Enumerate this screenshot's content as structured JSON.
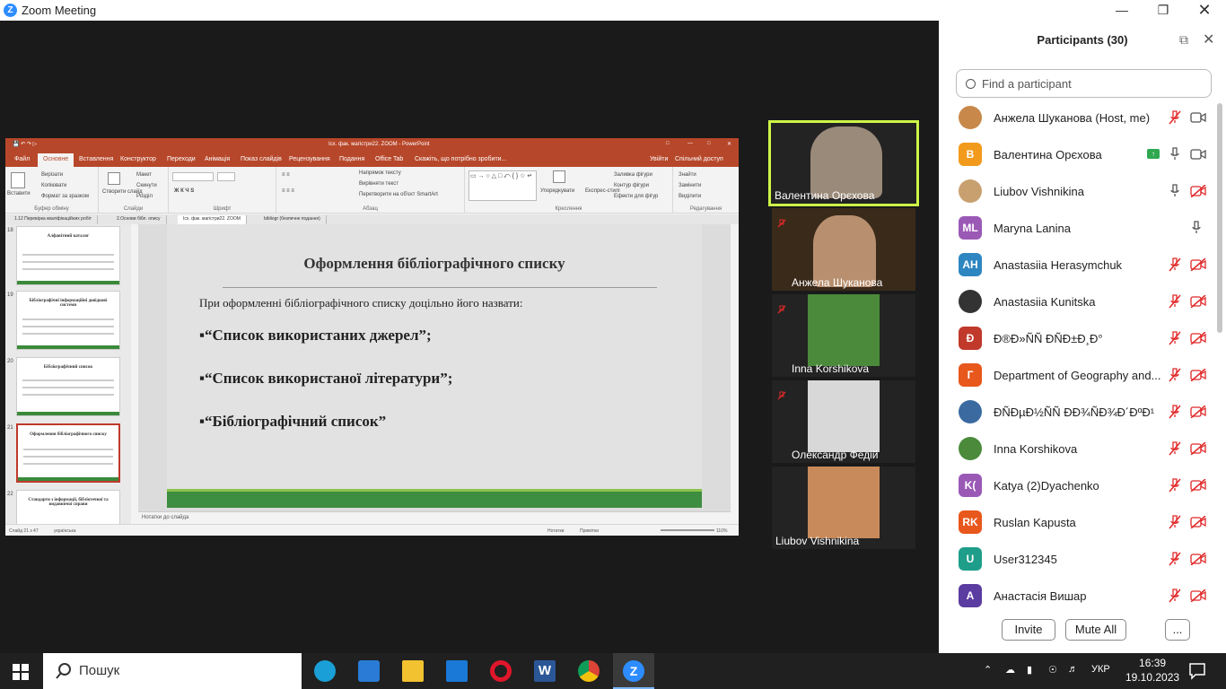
{
  "window": {
    "title": "Zoom Meeting",
    "logo": "Z"
  },
  "ppt": {
    "doc_title": "Ісх. фак. магістри22. ZOOM - PowerPoint",
    "tabs": [
      "Файл",
      "Основне",
      "Вставлення",
      "Конструктор",
      "Переходи",
      "Анімація",
      "Показ слайдів",
      "Рецензування",
      "Подання",
      "Office Tab",
      "Скажіть, що потрібно зробити...",
      "Увійти",
      "Спільний доступ"
    ],
    "ribbon": {
      "groups": [
        "Буфер обміну",
        "Слайди",
        "Шрифт",
        "Абзац",
        "Креслення",
        "Редагування"
      ],
      "clipboard": [
        "Вставити",
        "Вирізати",
        "Копіювати",
        "Формат за зразком"
      ],
      "slides": [
        "Створити слайд",
        "Макет",
        "Скинути",
        "Розділ"
      ],
      "paragraph": [
        "Напрямок тексту",
        "Вирівняти текст",
        "Перетворити на об'єкт SmartArt"
      ],
      "drawing": [
        "Упорядкувати",
        "Експрес-стилі",
        "Заливка фігури",
        "Контур фігури",
        "Ефекти для фігур"
      ],
      "editing": [
        "Знайти",
        "Замінити",
        "Виділити"
      ]
    },
    "doc_tabs": [
      "1.12 Перевірка кваліфікаційних робіт",
      "2.Основи бібл. опису",
      "Ісх. фак. магістри22. ZOOM",
      "bibliogr (безпечне подання)"
    ],
    "thumbs": [
      {
        "num": "18",
        "title": "Алфавітний каталог"
      },
      {
        "num": "19",
        "title": "Бібліографічні інформаційні довідкові системи"
      },
      {
        "num": "20",
        "title": "Бібліографічний список"
      },
      {
        "num": "21",
        "title": "Оформлення бібліографічного списку"
      },
      {
        "num": "22",
        "title": "Стандарти з інформації, бібліотечної та видавничої справи"
      }
    ],
    "slide": {
      "heading": "Оформлення бібліографічного списку",
      "intro": "При оформленні бібліографічного списку доцільно його назвати:",
      "bullets": [
        "▪“Список використаних джерел”;",
        "▪“Список використаної літератури”;",
        "▪“Бібліографічний список”"
      ]
    },
    "notes": "Нотатки до слайда",
    "status": {
      "slide": "Слайд 21 з 47",
      "lang": "українська",
      "notes_btn": "Нотатки",
      "comments_btn": "Примітки",
      "zoom": "110%"
    }
  },
  "videos": [
    {
      "name": "Валентина Орєхова",
      "muted": false,
      "active": true,
      "photo": "#9a8a7a"
    },
    {
      "name": "Анжела Шуканова",
      "muted": true,
      "active": false,
      "photo": "#8a6a4a"
    },
    {
      "name": "Inna Korshikova",
      "muted": true,
      "active": false,
      "photo": "#4a8a3a"
    },
    {
      "name": "Олександр Федій",
      "muted": true,
      "active": false,
      "photo": "#d8d8d8"
    },
    {
      "name": "Liubov Vishnikina",
      "muted": false,
      "active": false,
      "photo": "#c88a5a"
    }
  ],
  "participants": {
    "title": "Participants (30)",
    "search_placeholder": "Find a participant",
    "list": [
      {
        "name": "Анжела Шуканова (Host, me)",
        "avatar": "",
        "color": "#c8884a",
        "img": true,
        "mic": "muted",
        "cam": "on"
      },
      {
        "name": "Валентина Орєхова",
        "avatar": "В",
        "color": "#f29a1c",
        "img": false,
        "mic": "on",
        "cam": "on",
        "share": true
      },
      {
        "name": "Liubov Vishnikina",
        "avatar": "",
        "color": "#c8a070",
        "img": true,
        "mic": "on",
        "cam": "off"
      },
      {
        "name": "Maryna Lanina",
        "avatar": "ML",
        "color": "#9b59b6",
        "img": false,
        "mic": "on",
        "cam": "none"
      },
      {
        "name": "Anastasiia Herasymchuk",
        "avatar": "AH",
        "color": "#2e86c1",
        "img": false,
        "mic": "muted",
        "cam": "off"
      },
      {
        "name": "Anastasiia Kunitska",
        "avatar": "",
        "color": "#333",
        "img": true,
        "mic": "muted",
        "cam": "off"
      },
      {
        "name": "Ð®Ð»ÑÑ ÐÑÐ±Ð¸Ð°",
        "avatar": "Ð",
        "color": "#c0392b",
        "img": false,
        "mic": "muted",
        "cam": "off"
      },
      {
        "name": "Department of Geography and...",
        "avatar": "Г",
        "color": "#e8571c",
        "img": false,
        "mic": "muted",
        "cam": "off"
      },
      {
        "name": "ÐÑÐµÐ½ÑÑ ÐÐ¾ÑÐ¾Ð´ÐºÐ¹",
        "avatar": "",
        "color": "#3a6aa0",
        "img": true,
        "mic": "muted",
        "cam": "off"
      },
      {
        "name": "Inna Korshikova",
        "avatar": "",
        "color": "#4a8a3a",
        "img": true,
        "mic": "muted",
        "cam": "off"
      },
      {
        "name": "Katya (2)Dyachenko",
        "avatar": "K(",
        "color": "#9b59b6",
        "img": false,
        "mic": "muted",
        "cam": "off"
      },
      {
        "name": "Ruslan Kapusta",
        "avatar": "RK",
        "color": "#e8571c",
        "img": false,
        "mic": "muted",
        "cam": "off"
      },
      {
        "name": "User312345",
        "avatar": "U",
        "color": "#1e9e8a",
        "img": false,
        "mic": "muted",
        "cam": "off"
      },
      {
        "name": "Анастасія Вишар",
        "avatar": "А",
        "color": "#5b3ca0",
        "img": false,
        "mic": "muted",
        "cam": "off"
      }
    ],
    "invite": "Invite",
    "mute_all": "Mute All",
    "more": "..."
  },
  "taskbar": {
    "search": "Пошук",
    "lang": "УКР",
    "time": "16:39",
    "date": "19.10.2023",
    "apps": [
      "edge-icon",
      "store-icon",
      "explorer-icon",
      "mail-icon",
      "opera-icon",
      "word-icon",
      "chrome-icon",
      "zoom-icon"
    ]
  },
  "colors": {
    "ppt_accent": "#b7472a",
    "zoom_blue": "#2d8cff",
    "active_speaker": "#cdf547",
    "muted_red": "#e02828"
  }
}
